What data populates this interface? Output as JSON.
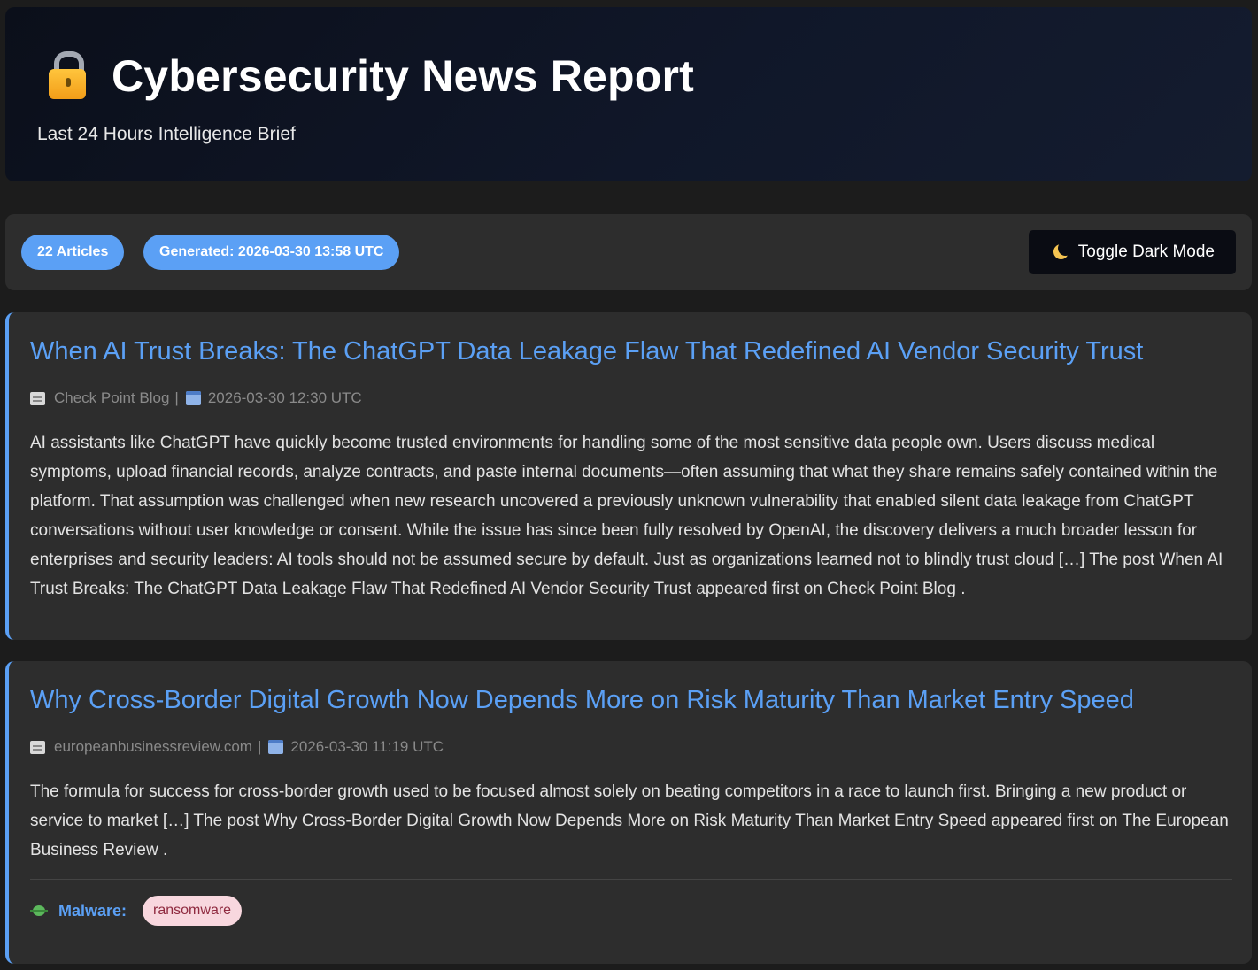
{
  "header": {
    "icon": "lock-icon",
    "title": "Cybersecurity News Report",
    "subtitle": "Last 24 Hours Intelligence Brief"
  },
  "stats": {
    "articles_label": "22 Articles",
    "generated_label": "Generated: 2026-03-30 13:58 UTC",
    "toggle_label": "Toggle Dark Mode",
    "toggle_icon": "moon-icon"
  },
  "colors": {
    "accent": "#5ba0f5",
    "background": "#1c1c1c",
    "card": "#2d2d2d",
    "tag_bg": "#f8d7de",
    "tag_text": "#8f2a3f"
  },
  "articles": [
    {
      "title": "When AI Trust Breaks: The ChatGPT Data Leakage Flaw That Redefined AI Vendor Security Trust",
      "source": "Check Point Blog",
      "separator": "|",
      "date": "2026-03-30 12:30 UTC",
      "summary": "AI assistants like ChatGPT have quickly become trusted environments for handling some of the most sensitive data people own. Users discuss medical symptoms, upload financial records, analyze contracts, and paste internal documents—often assuming that what they share remains safely contained within the platform.  That assumption was challenged when new research uncovered a previously unknown vulnerability that enabled silent data leakage from ChatGPT conversations without user knowledge or consent. While the issue has since been fully resolved by OpenAI, the discovery delivers a much broader lesson for enterprises and security leaders: AI tools should not be assumed secure by default.  Just as organizations learned not to blindly trust cloud […] The post When AI Trust Breaks: The ChatGPT Data Leakage Flaw That Redefined AI Vendor Security Trust appeared first on Check Point Blog ."
    },
    {
      "title": "Why Cross-Border Digital Growth Now Depends More on Risk Maturity Than Market Entry Speed",
      "source": "europeanbusinessreview.com",
      "separator": "|",
      "date": "2026-03-30 11:19 UTC",
      "summary": "The formula for success for cross-border growth used to be focused almost solely on beating competitors in a race to launch first. Bringing a new product or service to market […] The post Why Cross-Border Digital Growth Now Depends More on Risk Maturity Than Market Entry Speed appeared first on The European Business Review .",
      "tags": {
        "icon": "bug-icon",
        "label": "Malware:",
        "items": [
          "ransomware"
        ]
      }
    }
  ]
}
